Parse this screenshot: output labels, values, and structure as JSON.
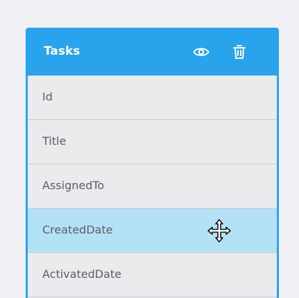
{
  "panel": {
    "title": "Tasks",
    "actions": [
      {
        "icon": "eye-icon"
      },
      {
        "icon": "trash-icon"
      }
    ],
    "fields": [
      {
        "label": "Id"
      },
      {
        "label": "Title"
      },
      {
        "label": "AssignedTo"
      },
      {
        "label": "CreatedDate",
        "selected": true
      },
      {
        "label": "ActivatedDate"
      }
    ]
  },
  "colors": {
    "accent": "#29a3ec",
    "row_background": "#ebebee",
    "selected_row": "#b3e2f7",
    "text": "#5b5d64",
    "page_background": "#eff0f3"
  },
  "cursor": {
    "icon": "move-cursor-icon"
  }
}
